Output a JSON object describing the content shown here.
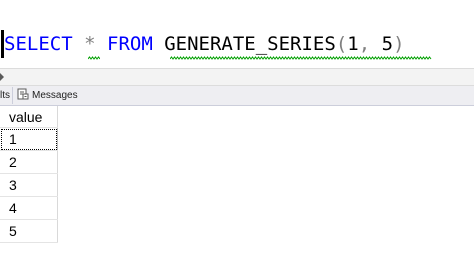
{
  "editor": {
    "tokens": {
      "select": "SELECT",
      "star": "*",
      "from": "FROM",
      "function": "GENERATE_SERIES",
      "open_paren": "(",
      "arg1": "1",
      "comma": ",",
      "arg2": "5",
      "close_paren": ")"
    }
  },
  "results_pane": {
    "tabs": {
      "results_label": "lts",
      "messages_label": "Messages"
    },
    "grid": {
      "column_header": "value",
      "rows": [
        "1",
        "2",
        "3",
        "4",
        "5"
      ]
    }
  },
  "icons": {
    "messages_tab": "messages-icon",
    "collapse": "collapse-triangle-icon"
  },
  "colors": {
    "keyword": "#0000ff",
    "operator": "#808080",
    "squiggle": "#00a000",
    "tab_strip": "#eeeef2"
  }
}
